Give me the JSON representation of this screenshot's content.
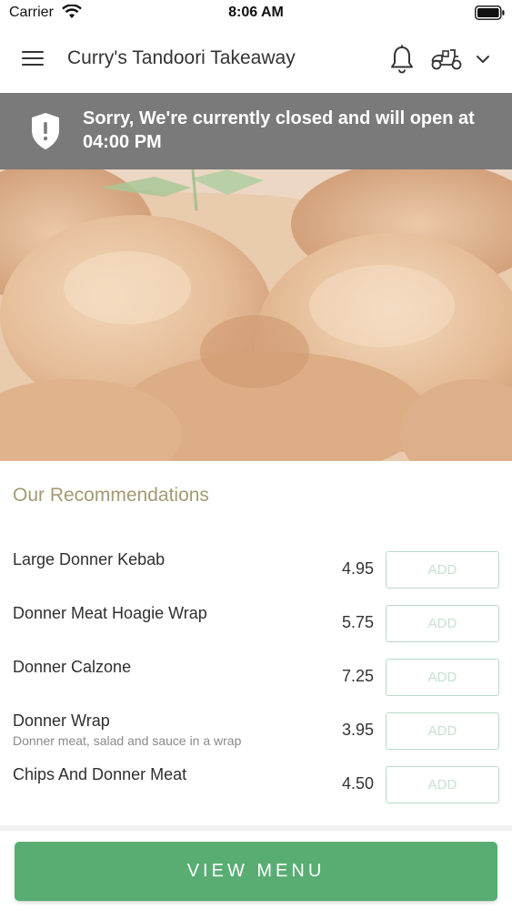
{
  "status_bar": {
    "carrier": "Carrier",
    "time": "8:06 AM",
    "wifi_icon": "wifi-icon",
    "battery_icon": "battery-icon"
  },
  "header": {
    "title": "Curry's Tandoori Takeaway",
    "menu_icon": "hamburger-menu-icon",
    "notification_icon": "bell-icon",
    "delivery_icon": "scooter-icon",
    "dropdown_icon": "chevron-down-icon"
  },
  "closed_banner": {
    "message": "Sorry, We're currently closed and will open at 04:00 PM",
    "icon": "shield-alert-icon",
    "background": "#7a7a7a"
  },
  "hero": {
    "image": "curry-chicken-photo"
  },
  "recommendations": {
    "title": "Our Recommendations",
    "items": [
      {
        "name": "Large Donner Kebab",
        "description": "",
        "price": "4.95",
        "add_label": "ADD"
      },
      {
        "name": "Donner Meat Hoagie Wrap",
        "description": "",
        "price": "5.75",
        "add_label": "ADD"
      },
      {
        "name": "Donner Calzone",
        "description": "",
        "price": "7.25",
        "add_label": "ADD"
      },
      {
        "name": "Donner Wrap",
        "description": "Donner meat, salad and sauce in a wrap",
        "price": "3.95",
        "add_label": "ADD"
      },
      {
        "name": "Chips And Donner Meat",
        "description": "",
        "price": "4.50",
        "add_label": "ADD"
      }
    ]
  },
  "footer": {
    "view_menu_label": "VIEW MENU",
    "accent": "#59ad72"
  }
}
